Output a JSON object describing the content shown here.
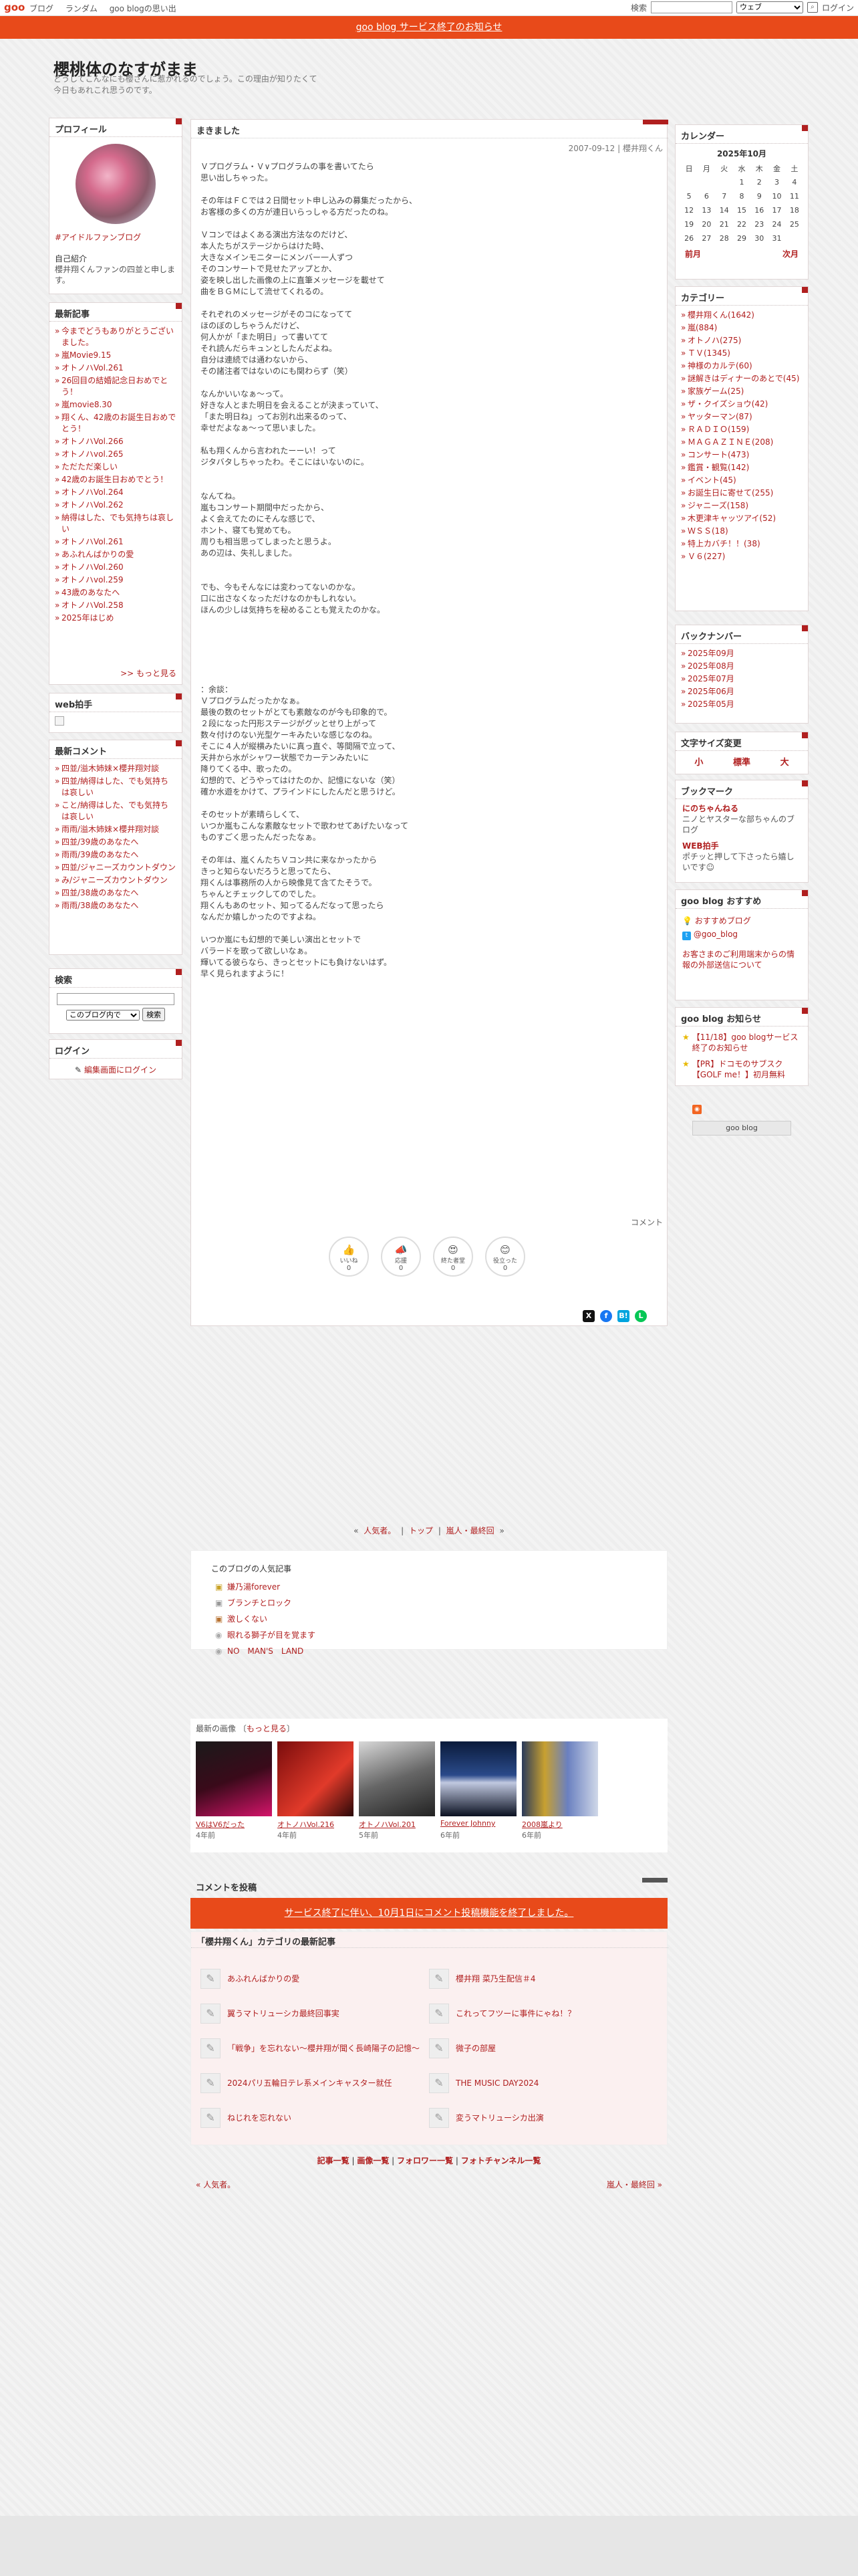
{
  "topbar": {
    "logo": "goo",
    "nav": [
      "ブログ",
      "ランダム",
      "goo blogの思い出"
    ],
    "search_label": "検索",
    "select_value": "ウェブ",
    "login": "ログイン",
    "search_icon": "search-icon"
  },
  "notice": "goo blog サービス終了のお知らせ",
  "header": {
    "title": "櫻桃体のなすがまま",
    "desc": "どうしてこんなにも櫻さんに惹かれるのでしょう。この理由が知りたくて今日もあれこれ思うのです。"
  },
  "profile": {
    "title": "プロフィール",
    "link": "#アイドルファンブログ",
    "self_label": "自己紹介",
    "self_text": "櫻井翔くんファンの四並と申します。"
  },
  "recent": {
    "title": "最新記事",
    "items": [
      "今までどうもありがとうございました。",
      "嵐Movie9.15",
      "オトノハVol.261",
      "26回目の結婚記念日おめでとう！",
      "嵐movie8.30",
      "翔くん、42歳のお誕生日おめでとう！",
      "オトノハVol.266",
      "オトノハvol.265",
      "ただただ楽しい",
      "42歳のお誕生日おめでとう！",
      "オトノハVol.264",
      "オトノハVol.262",
      "納得はした、でも気持ちは哀しい",
      "オトノハVol.261",
      "あふれんばかりの愛",
      "オトノハVol.260",
      "オトノハvol.259",
      "43歳のあなたへ",
      "オトノハVol.258",
      "2025年はじめ"
    ],
    "more": ">> もっと見る"
  },
  "webclip": {
    "title": "web拍手"
  },
  "comments": {
    "title": "最新コメント",
    "items": [
      "四並/溢木姉妹×櫻井翔対談",
      "四並/納得はした、でも気持ちは哀しい",
      "こと/納得はした、でも気持ちは哀しい",
      "雨雨/溢木姉妹×櫻井翔対談",
      "四並/39歳のあなたへ",
      "雨雨/39歳のあなたへ",
      "四並/ジャニーズカウントダウン",
      "み/ジャニーズカウントダウン",
      "四並/38歳のあなたへ",
      "雨雨/38歳のあなたへ"
    ]
  },
  "search": {
    "title": "検索",
    "select": "このブログ内で",
    "button": "検索"
  },
  "login": {
    "title": "ログイン",
    "link": "編集画面にログイン"
  },
  "article": {
    "title": "まきました",
    "date": "2007-09-12 | 櫻井翔くん",
    "body": "Ｖプログラム・Ｖ∨プログラムの事を書いてたら\n思い出しちゃった。\n\nその年はＦＣでは２日間セット申し込みの募集だったから、\nお客様の多くの方が連日いらっしゃる方だったのね。\n\nＶコンではよくある演出方法なのだけど、\n本人たちがステージからはけた時、\n大きなメインモニターにメンバー一人ずつ\nそのコンサートで見せたアップとか、\n姿を映し出した画像の上に直筆メッセージを載せて\n曲をＢＧＭにして流せてくれるの。\n\nそれぞれのメッセージがそのコになってて\nほのぼのしちゃうんだけど、\n何人かが「また明日」って書いてて\nそれ読んだらキュンとしたんだよね。\n自分は連続では通わないから、\nその諸注者ではないのにも関わらず（笑）\n\nなんかいいなぁ～って。\n好きな人とまた明日を会えることが決まっていて、\n「また明日ね」ってお別れ出来るのって、\n幸せだよなぁ～って思いました。\n\n私も翔くんから言われたーーい！って\nジタバタしちゃったわ。そこにはいないのに。\n\n\nなんてね。\n嵐もコンサート期間中だったから、\nよく会えてたのにそんな感じで、\nホント、寝ても覚めても。\n周りも相当思ってしまったと思うよ。\nあの辺は、失礼しました。\n\n\nでも、今もそんなには変わってないのかな。\n口に出さなくなっただけなのかもしれない。\nほんの少しは気持ちを秘めることも覚えたのかな。\n\n\n\n\n\n\n：余談：\nＶプログラムだったかなぁ。\n最後の数のセットがとても素敵なのが今も印象的で。\n２段になった円形ステージがグッとせり上がって\n数々付けのない光型ケーキみたいな感じなのね。\nそこに４人が縦横みたいに真っ直ぐ、等間隔で立って、\n天井から水がシャワー状態でカーテンみたいに\n降りてくる中、歌ったの。\n幻想的で、どうやってはけたのか、記憶にないな（笑）\n確か水遊をかけて、プラインドにしたんだと思うけど。\n\nそのセットが素晴らしくて、\nいつか嵐もこんな素敵なセットで歌わせてあげたいなって\nものすごく思ったんだったなぁ。\n\nその年は、嵐くんたちＶコン共に来なかったから\nきっと知らないだろうと思ってたら、\n翔くんは事務所の人から映像見て含てたそうで。\nちゃんとチェックしてのでした。\n翔くんもあのセット、知ってるんだなって思ったら\nなんだか嬉しかったのですよね。\n\nいつか嵐にも幻想的で美しい演出とセットで\nバラードを歌って欲しいなぁ。\n輝いてる彼らなら、きっとセットにも負けないはず。\n早く見られますように！",
    "comment_label": "コメント"
  },
  "reactions": [
    {
      "label": "いいね",
      "icon": "thumbs-up-icon",
      "glyph": "👍",
      "count": "0"
    },
    {
      "label": "応援",
      "icon": "megaphone-icon",
      "glyph": "📣",
      "count": "0"
    },
    {
      "label": "終た者堂",
      "icon": "heart-eyes-icon",
      "glyph": "😍",
      "count": "0"
    },
    {
      "label": "役立った",
      "icon": "smile-icon",
      "glyph": "😊",
      "count": "0"
    }
  ],
  "nav": {
    "prev": "人気者。",
    "top": "トップ",
    "next": "嵐人・最終回"
  },
  "popular": {
    "title": "このブログの人気記事",
    "items": [
      "嫌乃湯forever",
      "ブランチとロック",
      "激しくない",
      "眼れる獅子が目を覚ます",
      "NO　MAN'S　LAND"
    ]
  },
  "images": {
    "title": "最新の画像",
    "more": "もっと見る",
    "items": [
      {
        "cap": "V6はV6だった",
        "age": "4年前"
      },
      {
        "cap": "オトノハVol.216",
        "age": "4年前"
      },
      {
        "cap": "オトノハVol.201",
        "age": "5年前"
      },
      {
        "cap": "Forever Johnny",
        "age": "6年前"
      },
      {
        "cap": "2008嵐より",
        "age": "6年前"
      }
    ]
  },
  "comment_post": {
    "title": "コメントを投稿",
    "banner": "サービス終了に伴い、10月1日にコメント投稿機能を終了しました。"
  },
  "category_latest": {
    "title": "「櫻井翔くん」カテゴリの最新記事",
    "items": [
      "あふれんばかりの愛",
      "櫻井翔 菜乃生配信＃4",
      "翼うマトリューシカ最終回事実",
      "これってフツーに事件にゃね！？",
      "「戦争」を忘れない～櫻井翔が聞く長崎陽子の記憶～",
      "微子の部屋",
      "2024パリ五輪日テレ系メインキャスター就任",
      "THE MUSIC DAY2024",
      "ねじれを忘れない",
      "変うマトリューシカ出演"
    ]
  },
  "footer": {
    "links": [
      "記事一覧",
      "画像一覧",
      "フォロワー一覧",
      "フォトチャンネル一覧"
    ],
    "prev": "« 人気者。",
    "next": "嵐人・最終回 »"
  },
  "calendar": {
    "title": "カレンダー",
    "month": "2025年10月",
    "days": [
      "日",
      "月",
      "火",
      "水",
      "木",
      "金",
      "土"
    ],
    "rows": [
      [
        "",
        "",
        "",
        "1",
        "2",
        "3",
        "4"
      ],
      [
        "5",
        "6",
        "7",
        "8",
        "9",
        "10",
        "11"
      ],
      [
        "12",
        "13",
        "14",
        "15",
        "16",
        "17",
        "18"
      ],
      [
        "19",
        "20",
        "21",
        "22",
        "23",
        "24",
        "25"
      ],
      [
        "26",
        "27",
        "28",
        "29",
        "30",
        "31",
        ""
      ]
    ],
    "prev": "前月",
    "next": "次月"
  },
  "categories": {
    "title": "カテゴリー",
    "items": [
      "櫻井翔くん(1642)",
      "嵐(884)",
      "オトノハ(275)",
      "ＴＶ(1345)",
      "神様のカルテ(60)",
      "謎解きはディナーのあとで(45)",
      "家族ゲーム(25)",
      "ザ・クイズショウ(42)",
      "ヤッターマン(87)",
      "ＲＡＤＩＯ(159)",
      "ＭＡＧＡＺＩＮＥ(208)",
      "コンサート(473)",
      "鑑賞・観覧(142)",
      "イベント(45)",
      "お誕生日に寄せて(255)",
      "ジャニーズ(158)",
      "木更津キャッツアイ(52)",
      "ＷＳＳ(18)",
      "特上カバチ！！(38)",
      "Ｖ６(227)"
    ]
  },
  "backnumber": {
    "title": "バックナンバー",
    "items": [
      "2025年09月",
      "2025年08月",
      "2025年07月",
      "2025年06月",
      "2025年05月"
    ]
  },
  "fontsize": {
    "title": "文字サイズ変更",
    "small": "小",
    "normal": "標準",
    "large": "大"
  },
  "bookmark": {
    "title": "ブックマーク",
    "items": [
      {
        "name": "にのちゃんねる",
        "desc": "ニノとヤスターな部ちゃんのブログ"
      },
      {
        "name": "WEB拍手",
        "desc": "ポチッと押して下さったら嬉しいです☺"
      }
    ]
  },
  "goo_recommend": {
    "title": "goo blog おすすめ",
    "items": [
      "おすすめブログ",
      "@goo_blog"
    ],
    "notice": "お客さまのご利用端末からの情報の外部送信について"
  },
  "goo_news": {
    "title": "goo blog お知らせ",
    "items": [
      "【11/18】goo blogサービス終了のお知らせ",
      "【PR】ドコモのサブスク【GOLF me！】初月無料"
    ]
  },
  "rss": "goo blog"
}
